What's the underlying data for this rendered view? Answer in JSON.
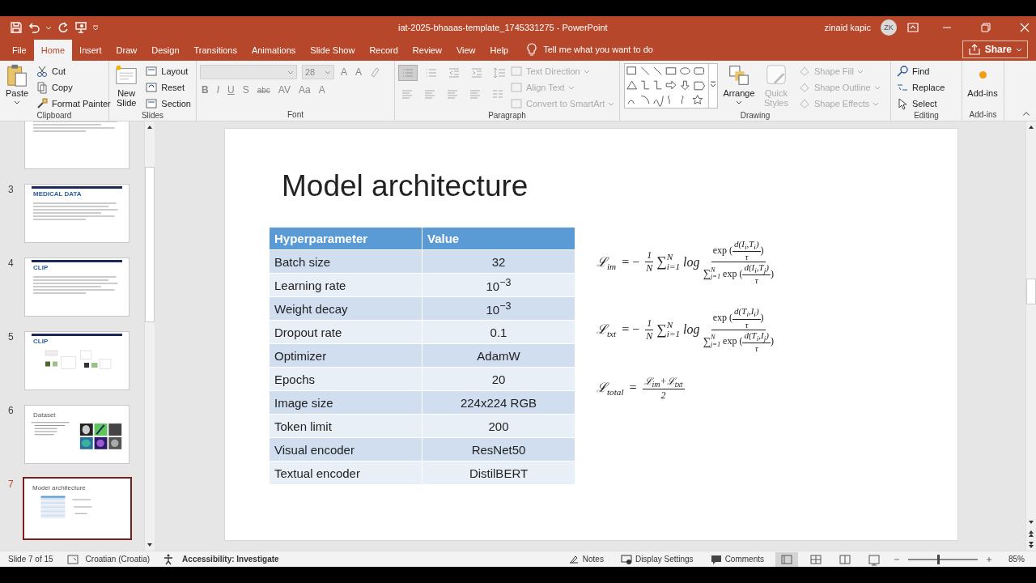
{
  "window": {
    "title": "iat-2025-bhaaas-template_1745331275  -  PowerPoint",
    "user": "zinaid kapic",
    "avatar": "ZK"
  },
  "tabs": [
    {
      "label": "File",
      "selected": false
    },
    {
      "label": "Home",
      "selected": true
    },
    {
      "label": "Insert",
      "selected": false
    },
    {
      "label": "Draw",
      "selected": false
    },
    {
      "label": "Design",
      "selected": false
    },
    {
      "label": "Transitions",
      "selected": false
    },
    {
      "label": "Animations",
      "selected": false
    },
    {
      "label": "Slide Show",
      "selected": false
    },
    {
      "label": "Record",
      "selected": false
    },
    {
      "label": "Review",
      "selected": false
    },
    {
      "label": "View",
      "selected": false
    },
    {
      "label": "Help",
      "selected": false
    }
  ],
  "tell_me": {
    "placeholder": "Tell me what you want to do"
  },
  "share": "Share",
  "ribbon": {
    "clipboard": {
      "label": "Clipboard",
      "paste": "Paste",
      "items": [
        "Cut",
        "Copy",
        "Format Painter"
      ]
    },
    "slides": {
      "label": "Slides",
      "new_slide": "New Slide",
      "items": [
        "Layout",
        "Reset",
        "Section"
      ]
    },
    "font": {
      "label": "Font",
      "size": "28",
      "size_buttons": [
        "A",
        "A"
      ],
      "buttons": [
        "B",
        "I",
        "U",
        "S",
        "abc",
        "AV",
        "Aa",
        "A"
      ]
    },
    "paragraph": {
      "label": "Paragraph",
      "items": [
        {
          "label": "Text Direction",
          "disabled": true
        },
        {
          "label": "Align Text",
          "disabled": true
        },
        {
          "label": "Convert to SmartArt",
          "disabled": true
        }
      ]
    },
    "drawing": {
      "label": "Drawing",
      "arrange": "Arrange",
      "quick_styles": {
        "label": "Quick Styles",
        "disabled": true
      },
      "items": [
        {
          "label": "Shape Fill",
          "disabled": true
        },
        {
          "label": "Shape Outline",
          "disabled": true
        },
        {
          "label": "Shape Effects",
          "disabled": true
        }
      ]
    },
    "editing": {
      "label": "Editing",
      "items": [
        "Find",
        "Replace",
        "Select"
      ]
    },
    "addins": {
      "label": "Add-ins",
      "button": "Add-ins"
    }
  },
  "thumbnails": [
    {
      "kind": "text",
      "selected": false
    },
    {
      "number": "3",
      "title": "MEDICAL DATA",
      "kind": "text",
      "selected": false
    },
    {
      "number": "4",
      "title": "CLIP",
      "kind": "text",
      "selected": false
    },
    {
      "number": "5",
      "title": "CLIP",
      "kind": "diagram",
      "selected": false
    },
    {
      "number": "6",
      "title": "Dataset",
      "kind": "images",
      "selected": false
    },
    {
      "number": "7",
      "title": "Model architecture",
      "kind": "table",
      "selected": true
    }
  ],
  "slide": {
    "title": "Model architecture",
    "table": {
      "columns": [
        "Hyperparameter",
        "Value"
      ],
      "rows": [
        [
          "Batch size",
          "32"
        ],
        [
          "Learning rate",
          "10$^{−3}$"
        ],
        [
          "Weight decay",
          "10$^{−3}$"
        ],
        [
          "Dropout rate",
          "0.1"
        ],
        [
          "Optimizer",
          "AdamW"
        ],
        [
          "Epochs",
          "20"
        ],
        [
          "Image size",
          "224x224 RGB"
        ],
        [
          "Token limit",
          "200"
        ],
        [
          "Visual encoder",
          "ResNet50"
        ],
        [
          "Textual encoder",
          "DistilBERT"
        ]
      ]
    },
    "formulas": [
      {
        "symbol": "ℒ",
        "sub": "im",
        "parts": [
          {
            "kind": "op",
            "text": "= −"
          },
          {
            "kind": "frac",
            "num": "1",
            "den": "N"
          },
          {
            "kind": "sum",
            "text": "∑",
            "sup": "N",
            "sub": "i=1"
          },
          {
            "kind": "var",
            "text": "log"
          },
          {
            "kind": "loss_frac",
            "num": {
              "pre": "exp (",
              "inum": "d(I$_{i}$,T$_{i}$)",
              "iden": "τ",
              "post": ")"
            },
            "den": {
              "sum": "∑",
              "sup": "N",
              "sub": "j=1",
              "pre": "exp (",
              "inum": "d(I$_{i}$,T$_{j}$)",
              "iden": "τ",
              "post": ")"
            }
          }
        ]
      },
      {
        "symbol": "ℒ",
        "sub": "txt",
        "parts": [
          {
            "kind": "op",
            "text": "= −"
          },
          {
            "kind": "frac",
            "num": "1",
            "den": "N"
          },
          {
            "kind": "sum",
            "text": "∑",
            "sup": "N",
            "sub": "i=1"
          },
          {
            "kind": "var",
            "text": "log"
          },
          {
            "kind": "loss_frac",
            "num": {
              "pre": "exp (",
              "inum": "d(T$_{i}$,I$_{i}$)",
              "iden": "τ",
              "post": ")"
            },
            "den": {
              "sum": "∑",
              "sup": "N",
              "sub": "j=1",
              "pre": "exp (",
              "inum": "d(T$_{i}$,I$_{j}$)",
              "iden": "τ",
              "post": ")"
            }
          }
        ]
      },
      {
        "symbol": "ℒ",
        "sub": "total",
        "parts": [
          {
            "kind": "op",
            "text": "="
          },
          {
            "kind": "frac",
            "num": "ℒ$_{im}$+ℒ$_{txt}$",
            "den": "2"
          }
        ]
      }
    ]
  },
  "status_bar": {
    "slide": "Slide 7 of 15",
    "language": "Croatian (Croatia)",
    "accessibility": "Accessibility: Investigate",
    "notes": "Notes",
    "display": "Display Settings",
    "comments": "Comments",
    "views": [
      {
        "selected": true
      },
      {
        "selected": false
      },
      {
        "selected": false
      },
      {
        "selected": false
      }
    ],
    "zoom": {
      "level": 0.43,
      "reading": "85%"
    }
  }
}
